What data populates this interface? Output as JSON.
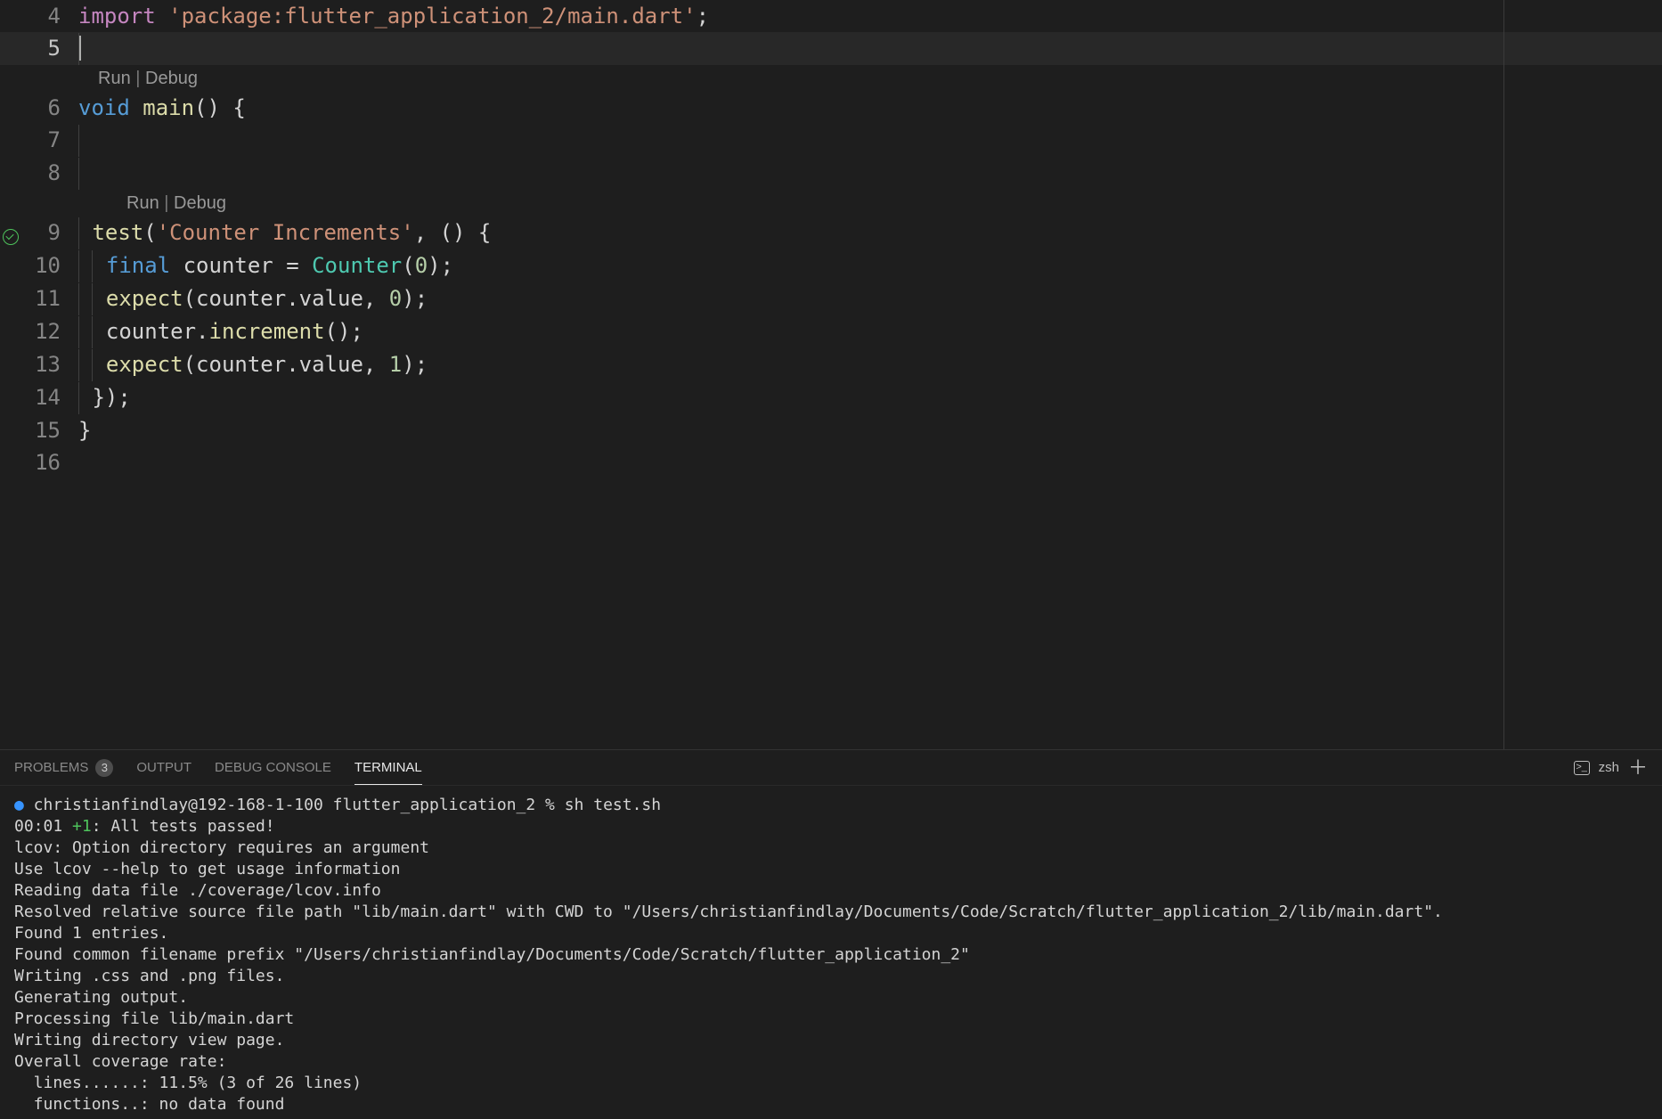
{
  "code": {
    "line4": {
      "num": "4",
      "kw": "import",
      "str": "'package:flutter_application_2/main.dart'",
      "semi": ";"
    },
    "line5": {
      "num": "5"
    },
    "codelens1": {
      "run": "Run",
      "sep": " | ",
      "debug": "Debug"
    },
    "line6": {
      "num": "6",
      "void": "void",
      "main": "main",
      "rest": "() {"
    },
    "line7": {
      "num": "7"
    },
    "line8": {
      "num": "8"
    },
    "codelens2": {
      "run": "Run",
      "sep": " | ",
      "debug": "Debug"
    },
    "line9": {
      "num": "9",
      "test": "test",
      "open": "(",
      "str": "'Counter Increments'",
      "mid": ", () {"
    },
    "line10": {
      "num": "10",
      "final": "final",
      "counter": " counter ",
      "eq": "= ",
      "type": "Counter",
      "open": "(",
      "zero": "0",
      "close": ");"
    },
    "line11": {
      "num": "11",
      "expect": "expect",
      "open": "(counter.value, ",
      "zero": "0",
      "close": ");"
    },
    "line12": {
      "num": "12",
      "body": "counter.",
      "inc": "increment",
      "rest": "();"
    },
    "line13": {
      "num": "13",
      "expect": "expect",
      "open": "(counter.value, ",
      "one": "1",
      "close": ");"
    },
    "line14": {
      "num": "14",
      "body": "});"
    },
    "line15": {
      "num": "15",
      "body": "}"
    },
    "line16": {
      "num": "16"
    }
  },
  "panel": {
    "tabs": {
      "problems": "PROBLEMS",
      "problems_badge": "3",
      "output": "OUTPUT",
      "debug_console": "DEBUG CONSOLE",
      "terminal": "TERMINAL"
    },
    "shell_label": "zsh"
  },
  "terminal": {
    "prompt_dot": "●",
    "prompt_userhost": " christianfindlay@192-168-1-100",
    "prompt_dir": " flutter_application_2",
    "prompt_sym": " % ",
    "prompt_cmd": "sh test.sh",
    "l2a": "00:01 ",
    "l2b": "+1",
    "l2c": ": All tests passed!",
    "l3": "lcov: Option directory requires an argument",
    "l4": "Use lcov --help to get usage information",
    "l5": "Reading data file ./coverage/lcov.info",
    "l6": "Resolved relative source file path \"lib/main.dart\" with CWD to \"/Users/christianfindlay/Documents/Code/Scratch/flutter_application_2/lib/main.dart\".",
    "l7": "Found 1 entries.",
    "l8": "Found common filename prefix \"/Users/christianfindlay/Documents/Code/Scratch/flutter_application_2\"",
    "l9": "Writing .css and .png files.",
    "l10": "Generating output.",
    "l11": "Processing file lib/main.dart",
    "l12": "Writing directory view page.",
    "l13": "Overall coverage rate:",
    "l14": "  lines......: 11.5% (3 of 26 lines)",
    "l15": "  functions..: no data found"
  }
}
